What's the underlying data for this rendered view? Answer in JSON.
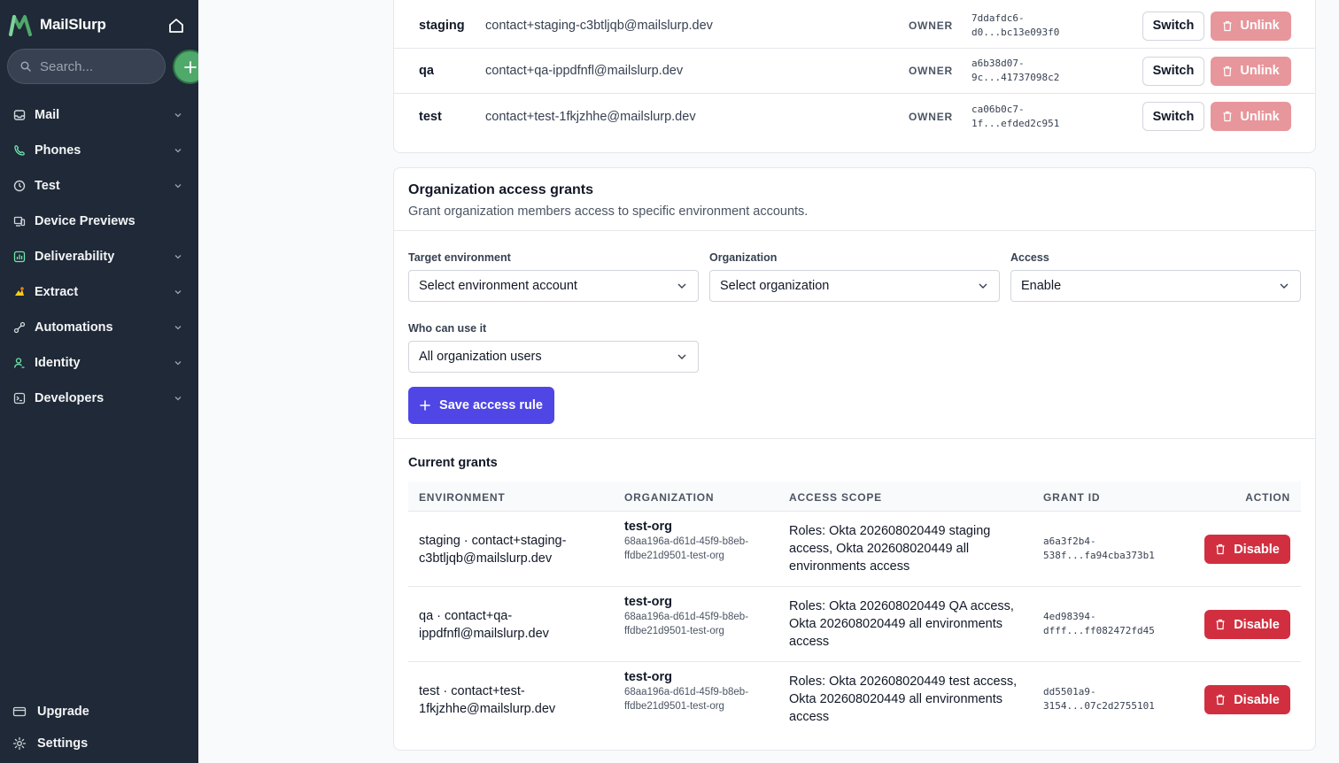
{
  "app": {
    "name": "MailSlurp"
  },
  "search": {
    "placeholder": "Search..."
  },
  "sidebar": {
    "items": [
      {
        "label": "Mail",
        "icon": "inbox-icon",
        "has_chevron": true
      },
      {
        "label": "Phones",
        "icon": "phone-icon",
        "has_chevron": true
      },
      {
        "label": "Test",
        "icon": "clock-icon",
        "has_chevron": true
      },
      {
        "label": "Device Previews",
        "icon": "devices-icon",
        "has_chevron": false
      },
      {
        "label": "Deliverability",
        "icon": "chart-icon",
        "has_chevron": true
      },
      {
        "label": "Extract",
        "icon": "extract-icon",
        "has_chevron": true
      },
      {
        "label": "Automations",
        "icon": "automation-icon",
        "has_chevron": true
      },
      {
        "label": "Identity",
        "icon": "user-icon",
        "has_chevron": true
      },
      {
        "label": "Developers",
        "icon": "terminal-icon",
        "has_chevron": true
      }
    ],
    "bottom": [
      {
        "label": "Upgrade",
        "icon": "card-icon"
      },
      {
        "label": "Settings",
        "icon": "gear-icon"
      }
    ]
  },
  "accounts": [
    {
      "env": "staging",
      "email": "contact+staging-c3btljqb@mailslurp.dev",
      "role": "OWNER",
      "id_line1": "7ddafdc6-",
      "id_line2": "d0...bc13e093f0",
      "switch_label": "Switch",
      "unlink_label": "Unlink"
    },
    {
      "env": "qa",
      "email": "contact+qa-ippdfnfl@mailslurp.dev",
      "role": "OWNER",
      "id_line1": "a6b38d07-",
      "id_line2": "9c...41737098c2",
      "switch_label": "Switch",
      "unlink_label": "Unlink"
    },
    {
      "env": "test",
      "email": "contact+test-1fkjzhhe@mailslurp.dev",
      "role": "OWNER",
      "id_line1": "ca06b0c7-",
      "id_line2": "1f...efded2c951",
      "switch_label": "Switch",
      "unlink_label": "Unlink"
    }
  ],
  "grants_section": {
    "title": "Organization access grants",
    "subtitle": "Grant organization members access to specific environment accounts.",
    "target_label": "Target environment",
    "target_value": "Select environment account",
    "org_label": "Organization",
    "org_value": "Select organization",
    "access_label": "Access",
    "access_value": "Enable",
    "who_label": "Who can use it",
    "who_value": "All organization users",
    "save_label": "Save access rule",
    "current_title": "Current grants",
    "columns": [
      "ENVIRONMENT",
      "ORGANIZATION",
      "ACCESS SCOPE",
      "GRANT ID",
      "ACTION"
    ],
    "rows": [
      {
        "environment": "staging · contact+staging-c3btljqb@mailslurp.dev",
        "org_name": "test-org",
        "org_id": "68aa196a-d61d-45f9-b8eb-ffdbe21d9501-test-org",
        "scope": "Roles: Okta 202608020449 staging access, Okta 202608020449 all environments access",
        "grant_id_line1": "a6a3f2b4-",
        "grant_id_line2": "538f...fa94cba373b1",
        "action": "Disable"
      },
      {
        "environment": "qa · contact+qa-ippdfnfl@mailslurp.dev",
        "org_name": "test-org",
        "org_id": "68aa196a-d61d-45f9-b8eb-ffdbe21d9501-test-org",
        "scope": "Roles: Okta 202608020449 QA access, Okta 202608020449 all environments access",
        "grant_id_line1": "4ed98394-",
        "grant_id_line2": "dfff...ff082472fd45",
        "action": "Disable"
      },
      {
        "environment": "test · contact+test-1fkjzhhe@mailslurp.dev",
        "org_name": "test-org",
        "org_id": "68aa196a-d61d-45f9-b8eb-ffdbe21d9501-test-org",
        "scope": "Roles: Okta 202608020449 test access, Okta 202608020449 all environments access",
        "grant_id_line1": "dd5501a9-",
        "grant_id_line2": "3154...07c2d2755101",
        "action": "Disable"
      }
    ]
  },
  "colors": {
    "sidebar_bg": "#1f2937",
    "primary": "#4f46e5",
    "danger": "#d12f3f",
    "danger_muted": "#e7969b",
    "brand_green": "#4fa96a"
  }
}
